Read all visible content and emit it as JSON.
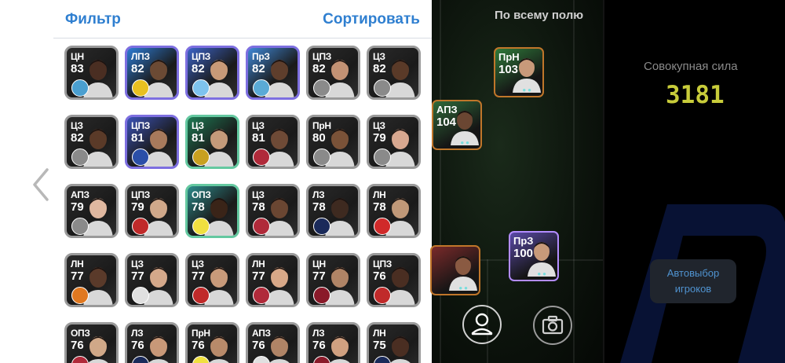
{
  "header": {
    "filter_label": "Фильтр",
    "sort_label": "Сортировать"
  },
  "players": [
    {
      "pos": "ЦН",
      "ovr": "83",
      "style": "dark",
      "badge": "#4a9fd0",
      "skin": "#4a2e22",
      "bg": "#2a2a2a"
    },
    {
      "pos": "ЛПЗ",
      "ovr": "82",
      "style": "blue",
      "badge": "#e8c020",
      "skin": "#6b4a34",
      "bg": "#2d7cd6"
    },
    {
      "pos": "ЦПЗ",
      "ovr": "82",
      "style": "blue",
      "badge": "#7ec3ee",
      "skin": "#c89a78",
      "bg": "#3b63c8"
    },
    {
      "pos": "ПрЗ",
      "ovr": "82",
      "style": "blue",
      "badge": "#5aaad6",
      "skin": "#5e3e2c",
      "bg": "#3f88d8"
    },
    {
      "pos": "ЦПЗ",
      "ovr": "82",
      "style": "dark",
      "badge": "#8a8a8a",
      "skin": "#c39274",
      "bg": "#2a2a2a"
    },
    {
      "pos": "ЦЗ",
      "ovr": "82",
      "style": "dark",
      "badge": "#8a8a8a",
      "skin": "#5a3a28",
      "bg": "#2a2a2a"
    },
    {
      "pos": "ЦЗ",
      "ovr": "82",
      "style": "dark",
      "badge": "#8a8a8a",
      "skin": "#5a3a28",
      "bg": "#2a2a2a"
    },
    {
      "pos": "ЦПЗ",
      "ovr": "81",
      "style": "blue",
      "badge": "#2b4fa8",
      "skin": "#a87a5c",
      "bg": "#3b52b8"
    },
    {
      "pos": "ЦЗ",
      "ovr": "81",
      "style": "green",
      "badge": "#c8a020",
      "skin": "#c49a7a",
      "bg": "#1e7a54"
    },
    {
      "pos": "ЦЗ",
      "ovr": "81",
      "style": "dark",
      "badge": "#b02a3a",
      "skin": "#6e4a36",
      "bg": "#2a2a2a"
    },
    {
      "pos": "ПрН",
      "ovr": "80",
      "style": "dark",
      "badge": "#8a8a8a",
      "skin": "#7a5238",
      "bg": "#2a2a2a"
    },
    {
      "pos": "ЦЗ",
      "ovr": "79",
      "style": "dark",
      "badge": "#8a8a8a",
      "skin": "#d8a890",
      "bg": "#2a2a2a"
    },
    {
      "pos": "АПЗ",
      "ovr": "79",
      "style": "dark",
      "badge": "#8a8a8a",
      "skin": "#e0b8a0",
      "bg": "#2a2a2a"
    },
    {
      "pos": "ЦПЗ",
      "ovr": "79",
      "style": "dark",
      "badge": "#c02a2a",
      "skin": "#d0a88a",
      "bg": "#2a2a2a"
    },
    {
      "pos": "ОПЗ",
      "ovr": "78",
      "style": "green",
      "badge": "#f0e040",
      "skin": "#3a2418",
      "bg": "#2c8a8a"
    },
    {
      "pos": "ЦЗ",
      "ovr": "78",
      "style": "dark",
      "badge": "#b02a3a",
      "skin": "#6a4632",
      "bg": "#2a2a2a"
    },
    {
      "pos": "ЛЗ",
      "ovr": "78",
      "style": "dark",
      "badge": "#1a2a5a",
      "skin": "#3e2a20",
      "bg": "#2a2a2a"
    },
    {
      "pos": "ЛН",
      "ovr": "78",
      "style": "dark",
      "badge": "#d02a2a",
      "skin": "#c09878",
      "bg": "#2a2a2a"
    },
    {
      "pos": "ЛН",
      "ovr": "77",
      "style": "dark",
      "badge": "#e07820",
      "skin": "#5a3a2a",
      "bg": "#2a2a2a"
    },
    {
      "pos": "ЦЗ",
      "ovr": "77",
      "style": "dark",
      "badge": "#e0e0e0",
      "skin": "#d4a88a",
      "bg": "#2a2a2a"
    },
    {
      "pos": "ЦЗ",
      "ovr": "77",
      "style": "dark",
      "badge": "#c02a2a",
      "skin": "#c89a7a",
      "bg": "#2a2a2a"
    },
    {
      "pos": "ЛН",
      "ovr": "77",
      "style": "dark",
      "badge": "#b02a3a",
      "skin": "#d8a888",
      "bg": "#2a2a2a"
    },
    {
      "pos": "ЦН",
      "ovr": "77",
      "style": "dark",
      "badge": "#8a1a2a",
      "skin": "#b08466",
      "bg": "#2a2a2a"
    },
    {
      "pos": "ЦПЗ",
      "ovr": "76",
      "style": "dark",
      "badge": "#c02a2a",
      "skin": "#4a2e22",
      "bg": "#2a2a2a"
    },
    {
      "pos": "ОПЗ",
      "ovr": "76",
      "style": "dark",
      "badge": "#b02a3a",
      "skin": "#d0a888",
      "bg": "#2a2a2a"
    },
    {
      "pos": "ЛЗ",
      "ovr": "76",
      "style": "dark",
      "badge": "#1a2a5a",
      "skin": "#c89878",
      "bg": "#2a2a2a"
    },
    {
      "pos": "ПрН",
      "ovr": "76",
      "style": "dark",
      "badge": "#f0e040",
      "skin": "#b88a6a",
      "bg": "#2a2a2a"
    },
    {
      "pos": "АПЗ",
      "ovr": "76",
      "style": "dark",
      "badge": "#e0e0e0",
      "skin": "#b08466",
      "bg": "#2a2a2a"
    },
    {
      "pos": "ЛЗ",
      "ovr": "76",
      "style": "dark",
      "badge": "#8a1a2a",
      "skin": "#d0a080",
      "bg": "#2a2a2a"
    },
    {
      "pos": "ЛН",
      "ovr": "75",
      "style": "dark",
      "badge": "#1a2a5a",
      "skin": "#4a2e22",
      "bg": "#2a2a2a"
    }
  ],
  "field": {
    "title": "По всему полю",
    "players": [
      {
        "pos": "ПрН",
        "ovr": "103",
        "border": "#c0762a",
        "bg": "#2f7a3a",
        "skin": "#c89a7a"
      },
      {
        "pos": "АПЗ",
        "ovr": "104",
        "border": "#c0762a",
        "bg": "#2f6a3a",
        "skin": "#6a4632"
      },
      {
        "pos": "ПрЗ",
        "ovr": "100",
        "border": "#b38cff",
        "bg": "#5a4aa8",
        "skin": "#c89a7a"
      },
      {
        "pos": "",
        "ovr": "",
        "border": "#c0762a",
        "bg": "#7a2a2a",
        "skin": "#8a5a42"
      }
    ]
  },
  "summary": {
    "strength_label": "Совокупная сила",
    "strength_value": "3181",
    "auto_select_line1": "Автовыбор",
    "auto_select_line2": "игроков"
  }
}
